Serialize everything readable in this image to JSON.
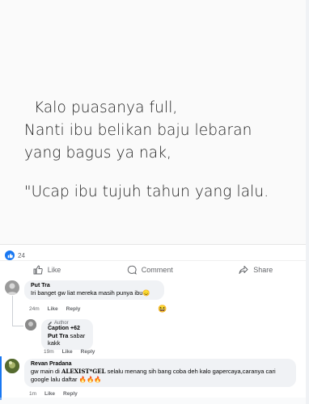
{
  "post": {
    "quote_lines": [
      "  Kalo puasanya full,",
      "Nanti ibu belikan baju lebaran",
      "yang bagus ya nak,"
    ],
    "quote_tail": "\"Ucap ibu tujuh tahun yang lalu."
  },
  "reactions": {
    "count": "24",
    "icon": "like-icon",
    "color": "#1877f2"
  },
  "actions": [
    {
      "label": "Like",
      "icon": "thumbs-up-icon"
    },
    {
      "label": "Comment",
      "icon": "comment-icon"
    },
    {
      "label": "Share",
      "icon": "share-icon"
    }
  ],
  "comments": [
    {
      "name": "Put Tra",
      "text": "Iri banget gw liat mereka masih punya ibu😞",
      "time": "24m",
      "like": "Like",
      "reply": "Reply",
      "reaction": "😆"
    },
    {
      "tag": "Author",
      "name": "Caption +62",
      "text_name": "Put Tra",
      "text": " sabar kakk",
      "time": "19m",
      "like": "Like",
      "reply": "Reply"
    },
    {
      "name": "Revan Pradana",
      "text_pre": "gw main di ",
      "text_bold": "ALEXIST*GEL",
      "text_post": " selalu menang sih bang coba deh kalo gapercaya,caranya cari google lalu daftar 🔥🔥🔥",
      "time": "1m",
      "like": "Like",
      "reply": "Reply"
    }
  ]
}
